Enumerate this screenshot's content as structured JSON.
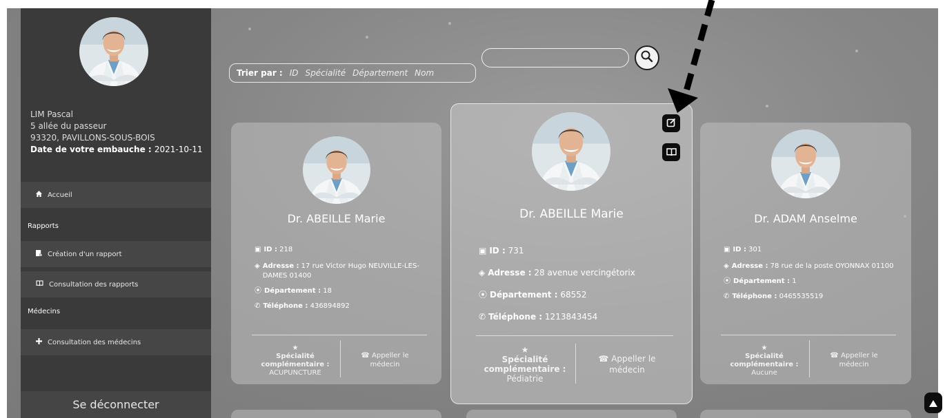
{
  "sidebar": {
    "user": {
      "name": "LIM Pascal",
      "street": "5 allée du passeur",
      "city": "93320, PAVILLONS-SOUS-BOIS",
      "hire_label": "Date de votre embauche :",
      "hire_date": "2021-10-11"
    },
    "home": "Accueil",
    "section_reports": "Rapports",
    "create_report": "Création d'un rapport",
    "view_reports": "Consultation des rapports",
    "section_doctors": "Médecins",
    "view_doctors": "Consultation des médecins",
    "logout": "Se déconnecter"
  },
  "sort": {
    "label": "Trier par :",
    "options": [
      "ID",
      "Spécialité",
      "Département",
      "Nom"
    ]
  },
  "search": {
    "placeholder": ""
  },
  "doctors": [
    {
      "name": "Dr. ABEILLE Marie",
      "id_label": "ID :",
      "id": "218",
      "address_label": "Adresse :",
      "address": "17 rue Victor Hugo NEUVILLE-LES-DAMES 01400",
      "dept_label": "Département :",
      "dept": "18",
      "phone_label": "Téléphone :",
      "phone": "436894892",
      "spec_label": "Spécialité complémentaire :",
      "spec": "ACUPUNCTURE",
      "call": "Appeller le médecin"
    },
    {
      "name": "Dr. ABEILLE Marie",
      "id_label": "ID :",
      "id": "731",
      "address_label": "Adresse :",
      "address": "28 avenue vercingétorix",
      "dept_label": "Département :",
      "dept": "68552",
      "phone_label": "Téléphone :",
      "phone": "1213843454",
      "spec_label": "Spécialité complémentaire :",
      "spec": "Pédiatrie",
      "call": "Appeller le médecin"
    },
    {
      "name": "Dr. ADAM Anselme",
      "id_label": "ID :",
      "id": "301",
      "address_label": "Adresse :",
      "address": "78 rue de la poste OYONNAX 01100",
      "dept_label": "Département :",
      "dept": "1",
      "phone_label": "Téléphone :",
      "phone": "0465535519",
      "spec_label": "Spécialité complémentaire :",
      "spec": "Aucune",
      "call": "Appeller le médecin"
    }
  ],
  "icons": {
    "edit": "edit-icon",
    "book": "book-icon",
    "search": "search-icon",
    "scroll_top": "arrow-up-icon"
  }
}
